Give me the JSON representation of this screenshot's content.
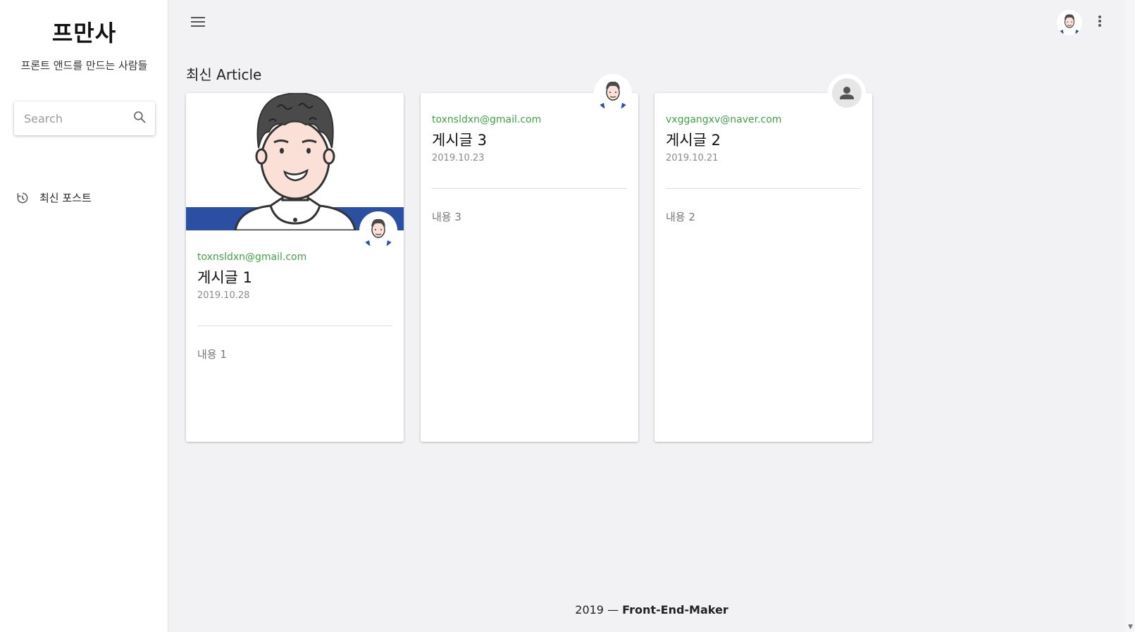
{
  "brand": {
    "title": "프만사",
    "subtitle": "프론트 앤드를 만드는 사람들"
  },
  "search": {
    "placeholder": "Search",
    "value": ""
  },
  "nav": {
    "items": [
      {
        "label": "최신 포스트",
        "icon": "history-icon"
      }
    ]
  },
  "topbar": {
    "menu_icon": "menu-icon",
    "more_icon": "more-vert-icon"
  },
  "section": {
    "title": "최신 Article"
  },
  "cards": [
    {
      "email": "toxnsldxn@gmail.com",
      "title": "게시글 1",
      "date": "2019.10.28",
      "content": "내용 1",
      "has_image": true
    },
    {
      "email": "toxnsldxn@gmail.com",
      "title": "게시글 3",
      "date": "2019.10.23",
      "content": "내용 3",
      "has_image": false
    },
    {
      "email": "vxggangxv@naver.com",
      "title": "게시글 2",
      "date": "2019.10.21",
      "content": "내용 2",
      "has_image": false
    }
  ],
  "footer": {
    "year": "2019",
    "separator": "—",
    "name": "Front-End-Maker"
  },
  "colors": {
    "accent_green": "#43a047",
    "brand_blue": "#2a4fa3",
    "background": "#f2f2f4"
  }
}
